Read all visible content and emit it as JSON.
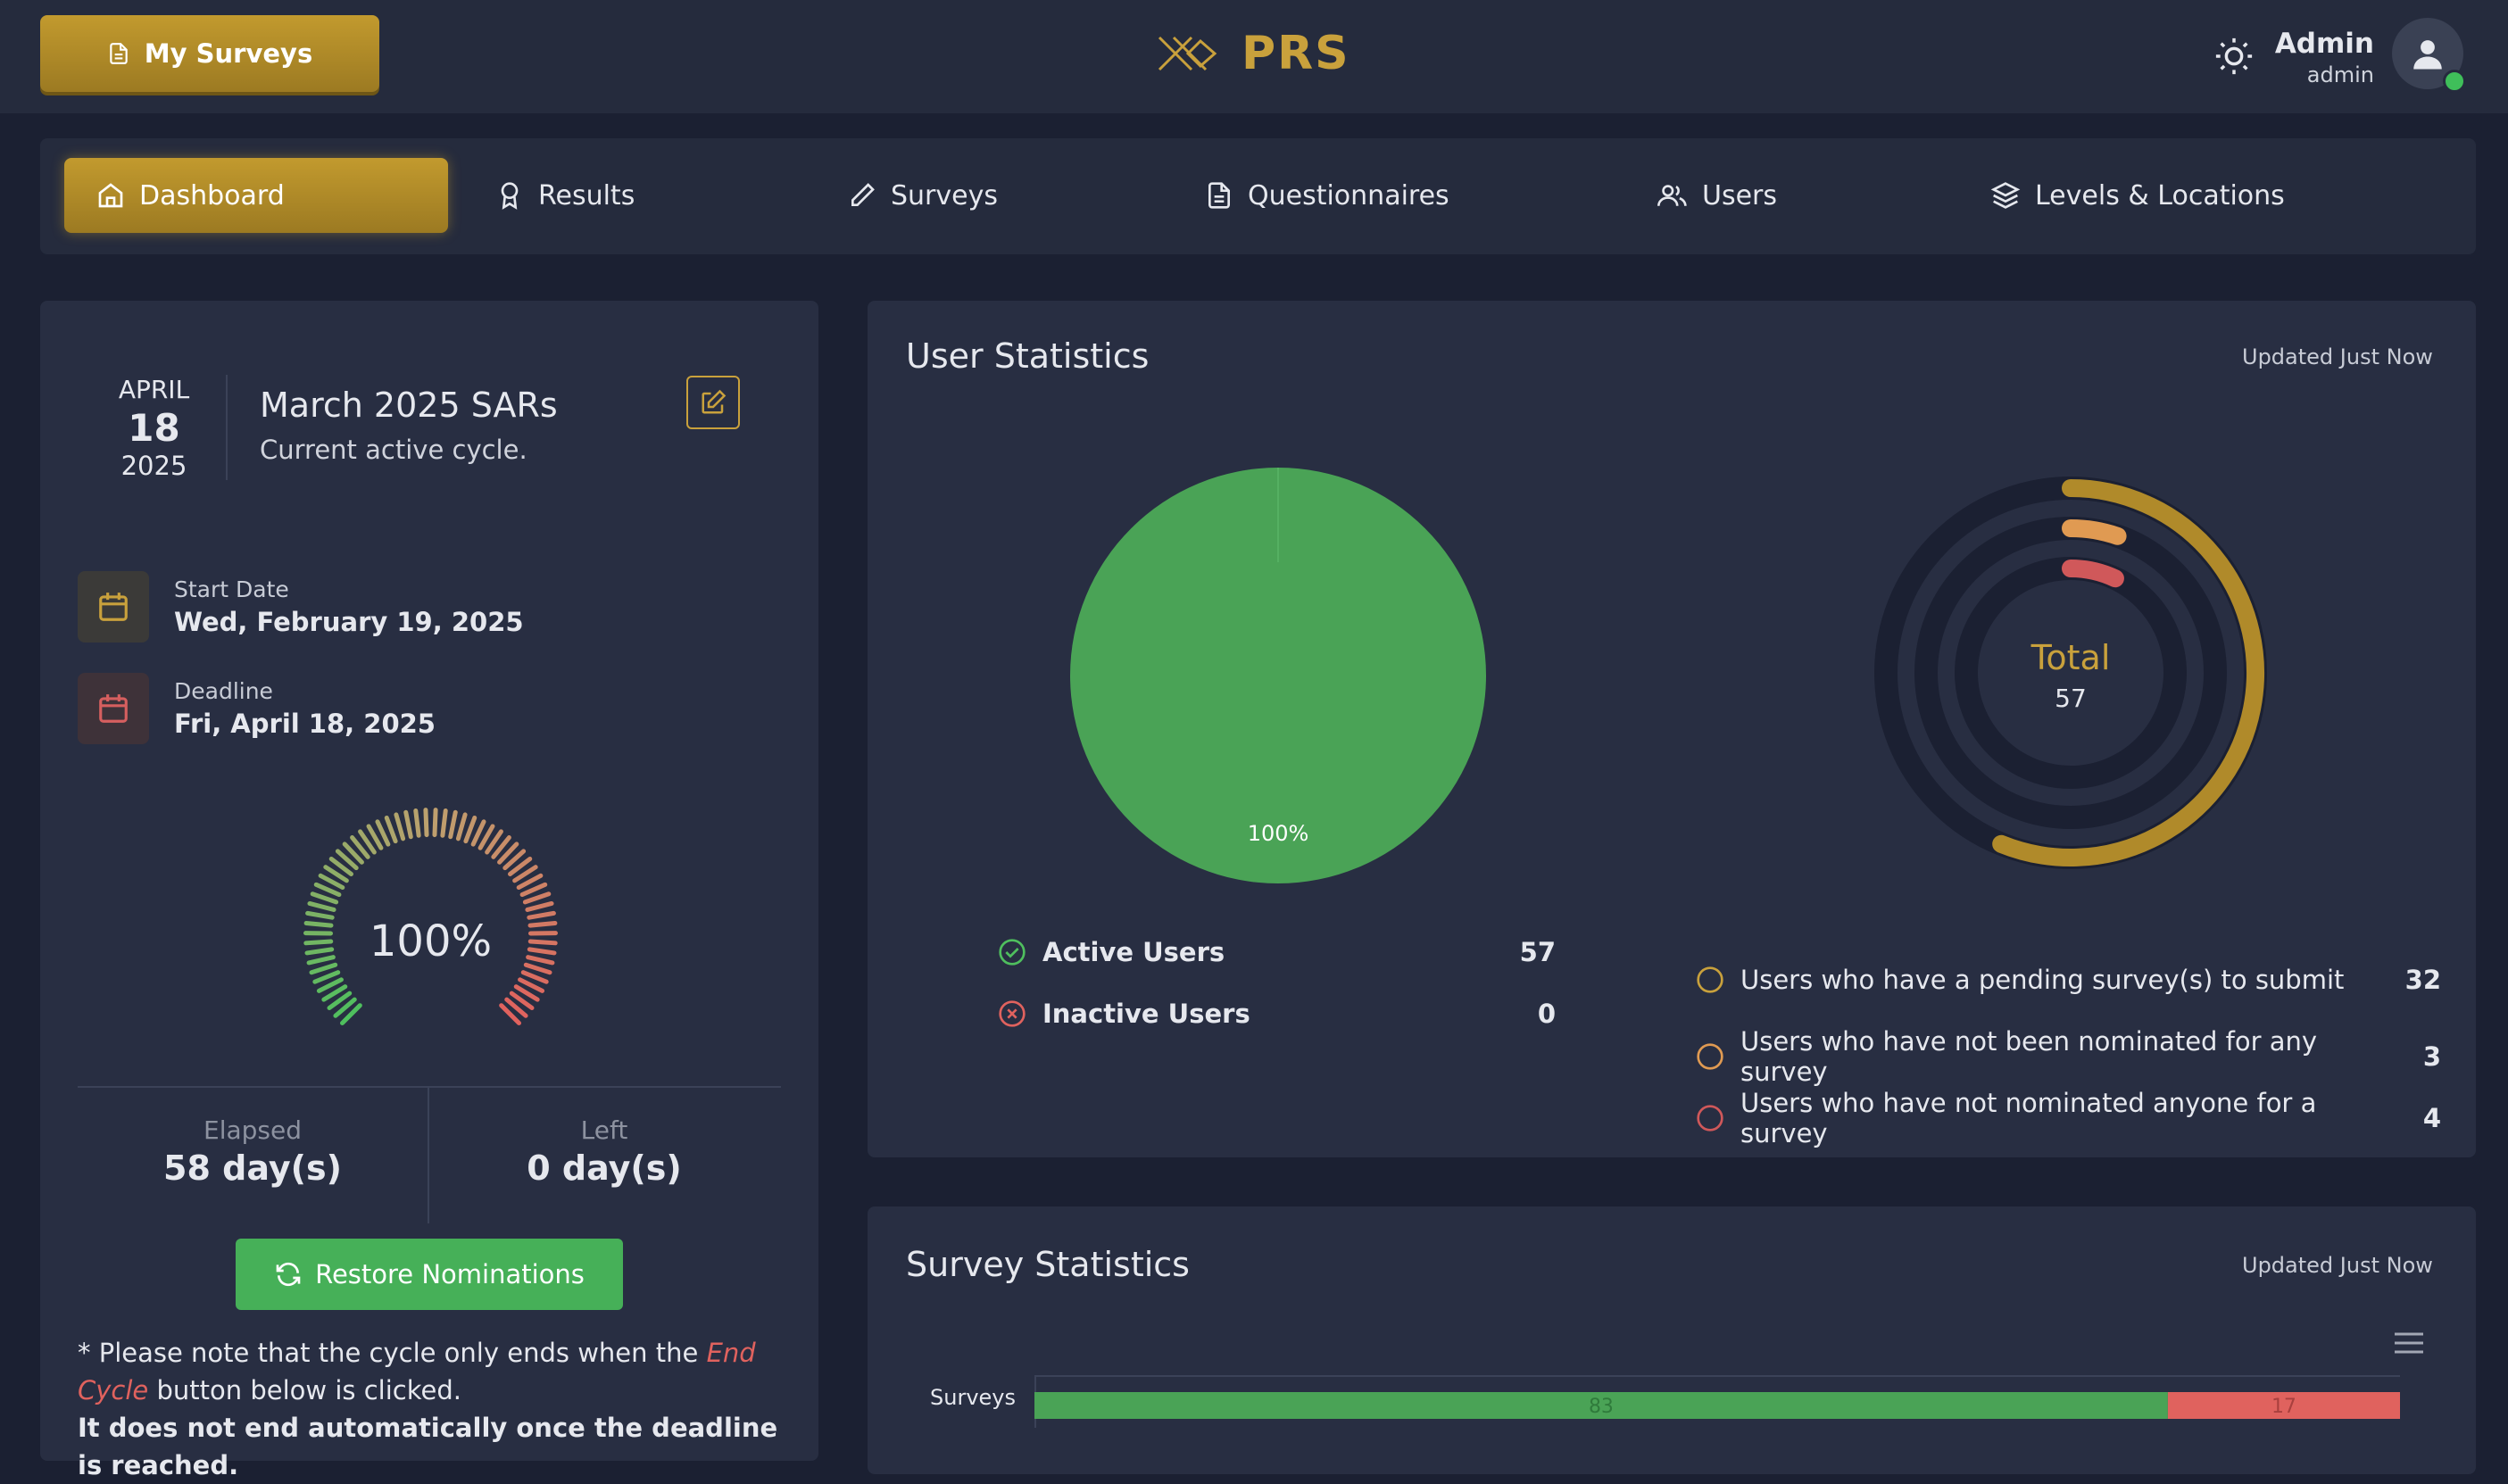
{
  "topbar": {
    "my_surveys_label": "My Surveys",
    "logo_text": "PRS",
    "user_name": "Admin",
    "user_role": "admin"
  },
  "nav": {
    "items": [
      {
        "label": "Dashboard",
        "icon": "home-icon",
        "active": true
      },
      {
        "label": "Results",
        "icon": "award-icon"
      },
      {
        "label": "Surveys",
        "icon": "pencil-icon"
      },
      {
        "label": "Questionnaires",
        "icon": "document-icon"
      },
      {
        "label": "Users",
        "icon": "users-icon"
      },
      {
        "label": "Levels & Locations",
        "icon": "layers-icon"
      }
    ]
  },
  "cycle": {
    "month": "APRIL",
    "day": "18",
    "year": "2025",
    "title": "March 2025 SARs",
    "subtitle": "Current active cycle.",
    "start_label": "Start Date",
    "start_value": "Wed, February 19, 2025",
    "deadline_label": "Deadline",
    "deadline_value": "Fri, April 18, 2025",
    "progress_percent": 100,
    "progress_label": "100%",
    "elapsed_label": "Elapsed",
    "elapsed_value": "58 day(s)",
    "left_label": "Left",
    "left_value": "0 day(s)",
    "restore_label": "Restore Nominations",
    "note_prefix": "* Please note that the cycle only ends when the ",
    "note_link": "End Cycle",
    "note_suffix": " button below is clicked.",
    "note_cutoff": "It does not end automatically once the deadline is reached."
  },
  "user_stats": {
    "title": "User Statistics",
    "updated": "Updated Just Now",
    "pie_label": "100%",
    "active_label": "Active Users",
    "active_value": "57",
    "inactive_label": "Inactive Users",
    "inactive_value": "0",
    "total_label": "Total",
    "total_value": "57",
    "pending_label": "Users who have a pending survey(s) to submit",
    "pending_value": "32",
    "not_nominated_label": "Users who have not been nominated for any survey",
    "not_nominated_value": "3",
    "not_nominating_label": "Users who have not nominated anyone for a survey",
    "not_nominating_value": "4",
    "colors": {
      "active": "#4aa356",
      "inactive": "#e0625e",
      "gold": "#b08a2a",
      "orange": "#e09a52",
      "red": "#d0585a"
    }
  },
  "survey_stats": {
    "title": "Survey Statistics",
    "updated": "Updated Just Now",
    "category_label": "Surveys",
    "completed_value": "83",
    "pending_value": "17"
  },
  "chart_data": [
    {
      "type": "pie",
      "labels": [
        "Active Users",
        "Inactive Users"
      ],
      "values": [
        57,
        0
      ],
      "colors": [
        "#4aa356",
        "#e0625e"
      ]
    },
    {
      "type": "radial-bar",
      "center_label": "Total",
      "center_value": 57,
      "labels": [
        "Users who have a pending survey(s) to submit",
        "Users who have not been nominated for any survey",
        "Users who have not nominated anyone for a survey"
      ],
      "values": [
        32,
        3,
        4
      ],
      "max": 57,
      "colors": [
        "#b08a2a",
        "#e09a52",
        "#d0585a"
      ]
    },
    {
      "type": "bar",
      "orientation": "horizontal",
      "stacked": true,
      "categories": [
        "Surveys"
      ],
      "series": [
        {
          "values": [
            83
          ],
          "color": "#4aa356"
        },
        {
          "values": [
            17
          ],
          "color": "#e0625e"
        }
      ]
    }
  ]
}
